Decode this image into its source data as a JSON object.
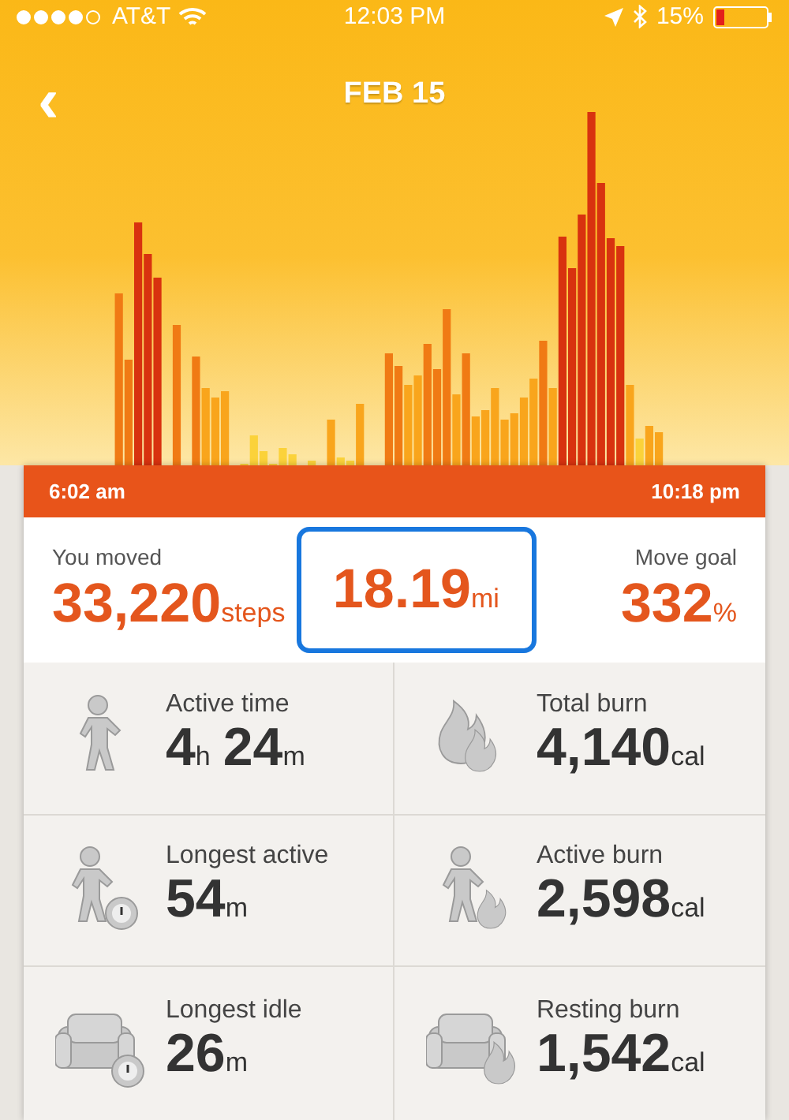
{
  "status_bar": {
    "carrier": "AT&T",
    "time": "12:03 PM",
    "battery": "15%"
  },
  "header": {
    "back": "‹",
    "title": "FEB 15"
  },
  "timeline": {
    "start": "6:02 am",
    "end": "10:18 pm"
  },
  "summary": [
    {
      "label": "You moved",
      "value": "33,220",
      "unit": "steps",
      "highlighted": false
    },
    {
      "value": "18.19",
      "unit": "mi",
      "highlighted": true
    },
    {
      "label": "Move goal",
      "value": "332",
      "unit": "%",
      "highlighted": false
    }
  ],
  "stats": [
    {
      "label": "Active time",
      "parts": [
        {
          "value": "4",
          "unit": "h"
        },
        {
          "value": "24",
          "unit": "m"
        }
      ]
    },
    {
      "label": "Total burn",
      "parts": [
        {
          "value": "4,140",
          "unit": "cal"
        }
      ]
    },
    {
      "label": "Longest active",
      "parts": [
        {
          "value": "54",
          "unit": "m"
        }
      ]
    },
    {
      "label": "Active burn",
      "parts": [
        {
          "value": "2,598",
          "unit": "cal"
        }
      ]
    },
    {
      "label": "Longest idle",
      "parts": [
        {
          "value": "26",
          "unit": "m"
        }
      ]
    },
    {
      "label": "Resting burn",
      "parts": [
        {
          "value": "1,542",
          "unit": "cal"
        }
      ]
    }
  ]
}
